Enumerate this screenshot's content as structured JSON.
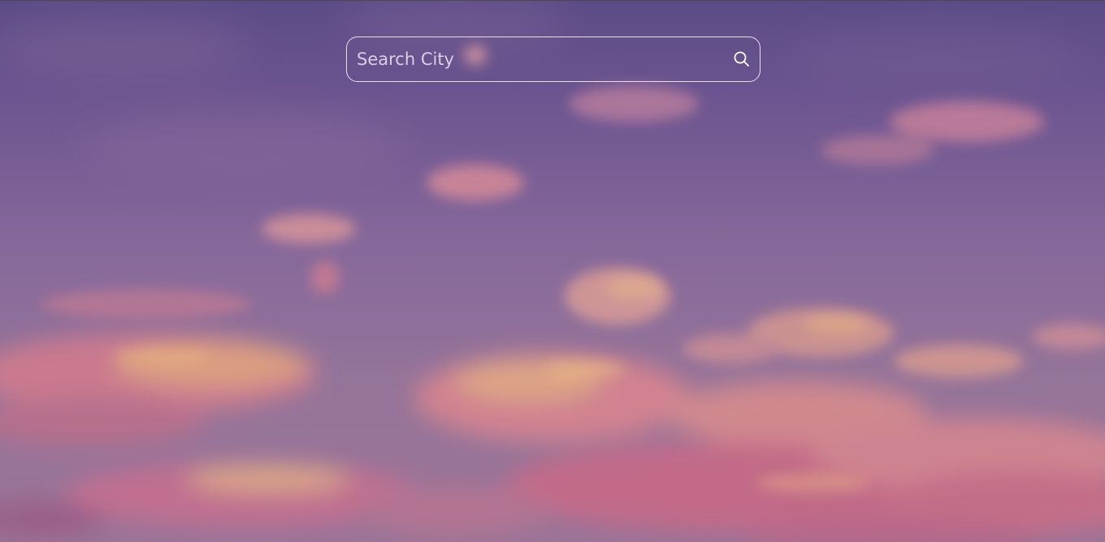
{
  "search": {
    "placeholder": "Search City",
    "value": "",
    "button_icon": "search-icon"
  },
  "colors": {
    "sky_top": "#5b4c86",
    "sky_bottom": "#9a7498",
    "cloud_pink": "#d07a8e",
    "cloud_gold": "#e0a27a",
    "search_border": "#e8dff0",
    "placeholder": "#d9cfe2"
  }
}
